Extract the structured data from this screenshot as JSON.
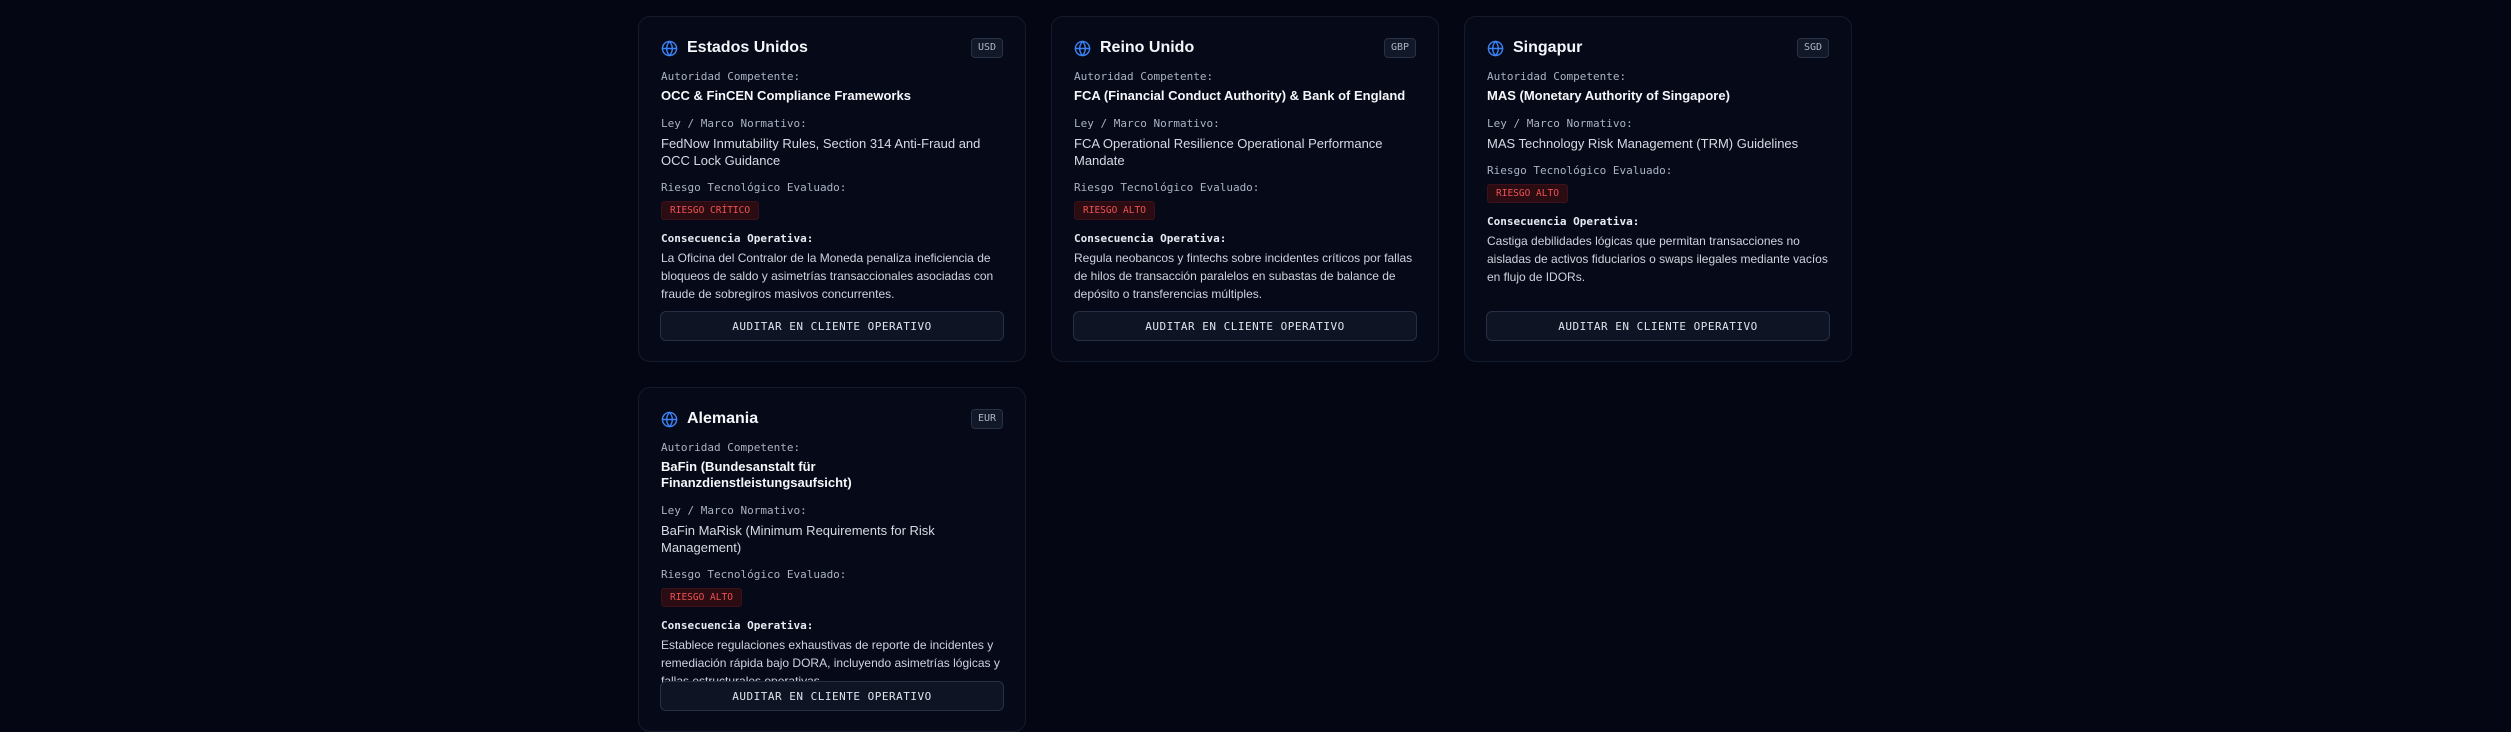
{
  "labels": {
    "authority": "Autoridad Competente:",
    "law": "Ley / Marco Normativo:",
    "risk": "Riesgo Tecnológico Evaluado:",
    "consequence": "Consecuencia Operativa:",
    "audit_button": "AUDITAR EN CLIENTE OPERATIVO"
  },
  "colors": {
    "background": "#040713",
    "card": "#060a18",
    "globe_icon": "#3b82f6",
    "risk_text": "#f05252"
  },
  "icons": {
    "country": "globe-icon"
  },
  "cards": [
    {
      "country": "Estados Unidos",
      "currency": "USD",
      "authority": "OCC & FinCEN Compliance Frameworks",
      "law": "FedNow Inmutability Rules, Section 314 Anti-Fraud and OCC Lock Guidance",
      "risk": "RIESGO CRÍTICO",
      "consequence": "La Oficina del Contralor de la Moneda penaliza ineficiencia de bloqueos de saldo y asimetrías transaccionales asociadas con fraude de sobregiros masivos concurrentes."
    },
    {
      "country": "Reino Unido",
      "currency": "GBP",
      "authority": "FCA (Financial Conduct Authority) & Bank of England",
      "law": "FCA Operational Resilience Operational Performance Mandate",
      "risk": "RIESGO ALTO",
      "consequence": "Regula neobancos y fintechs sobre incidentes críticos por fallas de hilos de transacción paralelos en subastas de balance de depósito o transferencias múltiples."
    },
    {
      "country": "Singapur",
      "currency": "SGD",
      "authority": "MAS (Monetary Authority of Singapore)",
      "law": "MAS Technology Risk Management (TRM) Guidelines",
      "risk": "RIESGO ALTO",
      "consequence": "Castiga debilidades lógicas que permitan transacciones no aisladas de activos fiduciarios o swaps ilegales mediante vacíos en flujo de IDORs."
    },
    {
      "country": "Alemania",
      "currency": "EUR",
      "authority": "BaFin (Bundesanstalt für Finanzdienstleistungsaufsicht)",
      "law": "BaFin MaRisk (Minimum Requirements for Risk Management)",
      "risk": "RIESGO ALTO",
      "consequence": "Establece regulaciones exhaustivas de reporte de incidentes y remediación rápida bajo DORA, incluyendo asimetrías lógicas y fallas estructurales operativas."
    }
  ]
}
